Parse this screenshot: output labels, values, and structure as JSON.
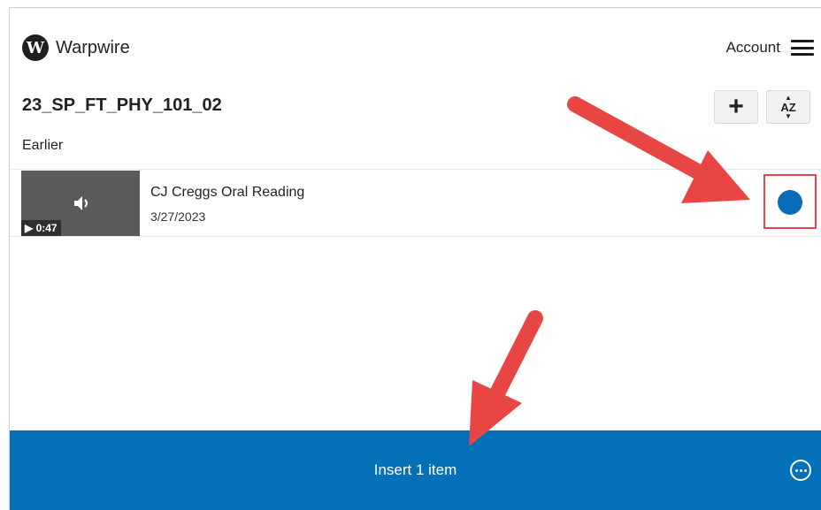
{
  "app": {
    "logo_letter": "W",
    "name": "Warpwire"
  },
  "header": {
    "account_label": "Account",
    "menu_icon": "hamburger-menu-icon"
  },
  "course": {
    "title": "23_SP_FT_PHY_101_02",
    "add_icon": "plus-icon",
    "sort_label": "AZ",
    "sort_icon": "sort-az-icon"
  },
  "list": {
    "section_label": "Earlier",
    "items": [
      {
        "title": "CJ Creggs Oral Reading",
        "date": "3/27/2023",
        "duration": "0:47",
        "thumbnail_icon": "speaker-icon",
        "selected": true
      }
    ]
  },
  "footer": {
    "insert_label": "Insert 1 item",
    "more_icon": "more-options-icon"
  },
  "colors": {
    "accent": "#0470b8",
    "selected_dot": "#0a6bb8",
    "annotation": "#e84545"
  }
}
